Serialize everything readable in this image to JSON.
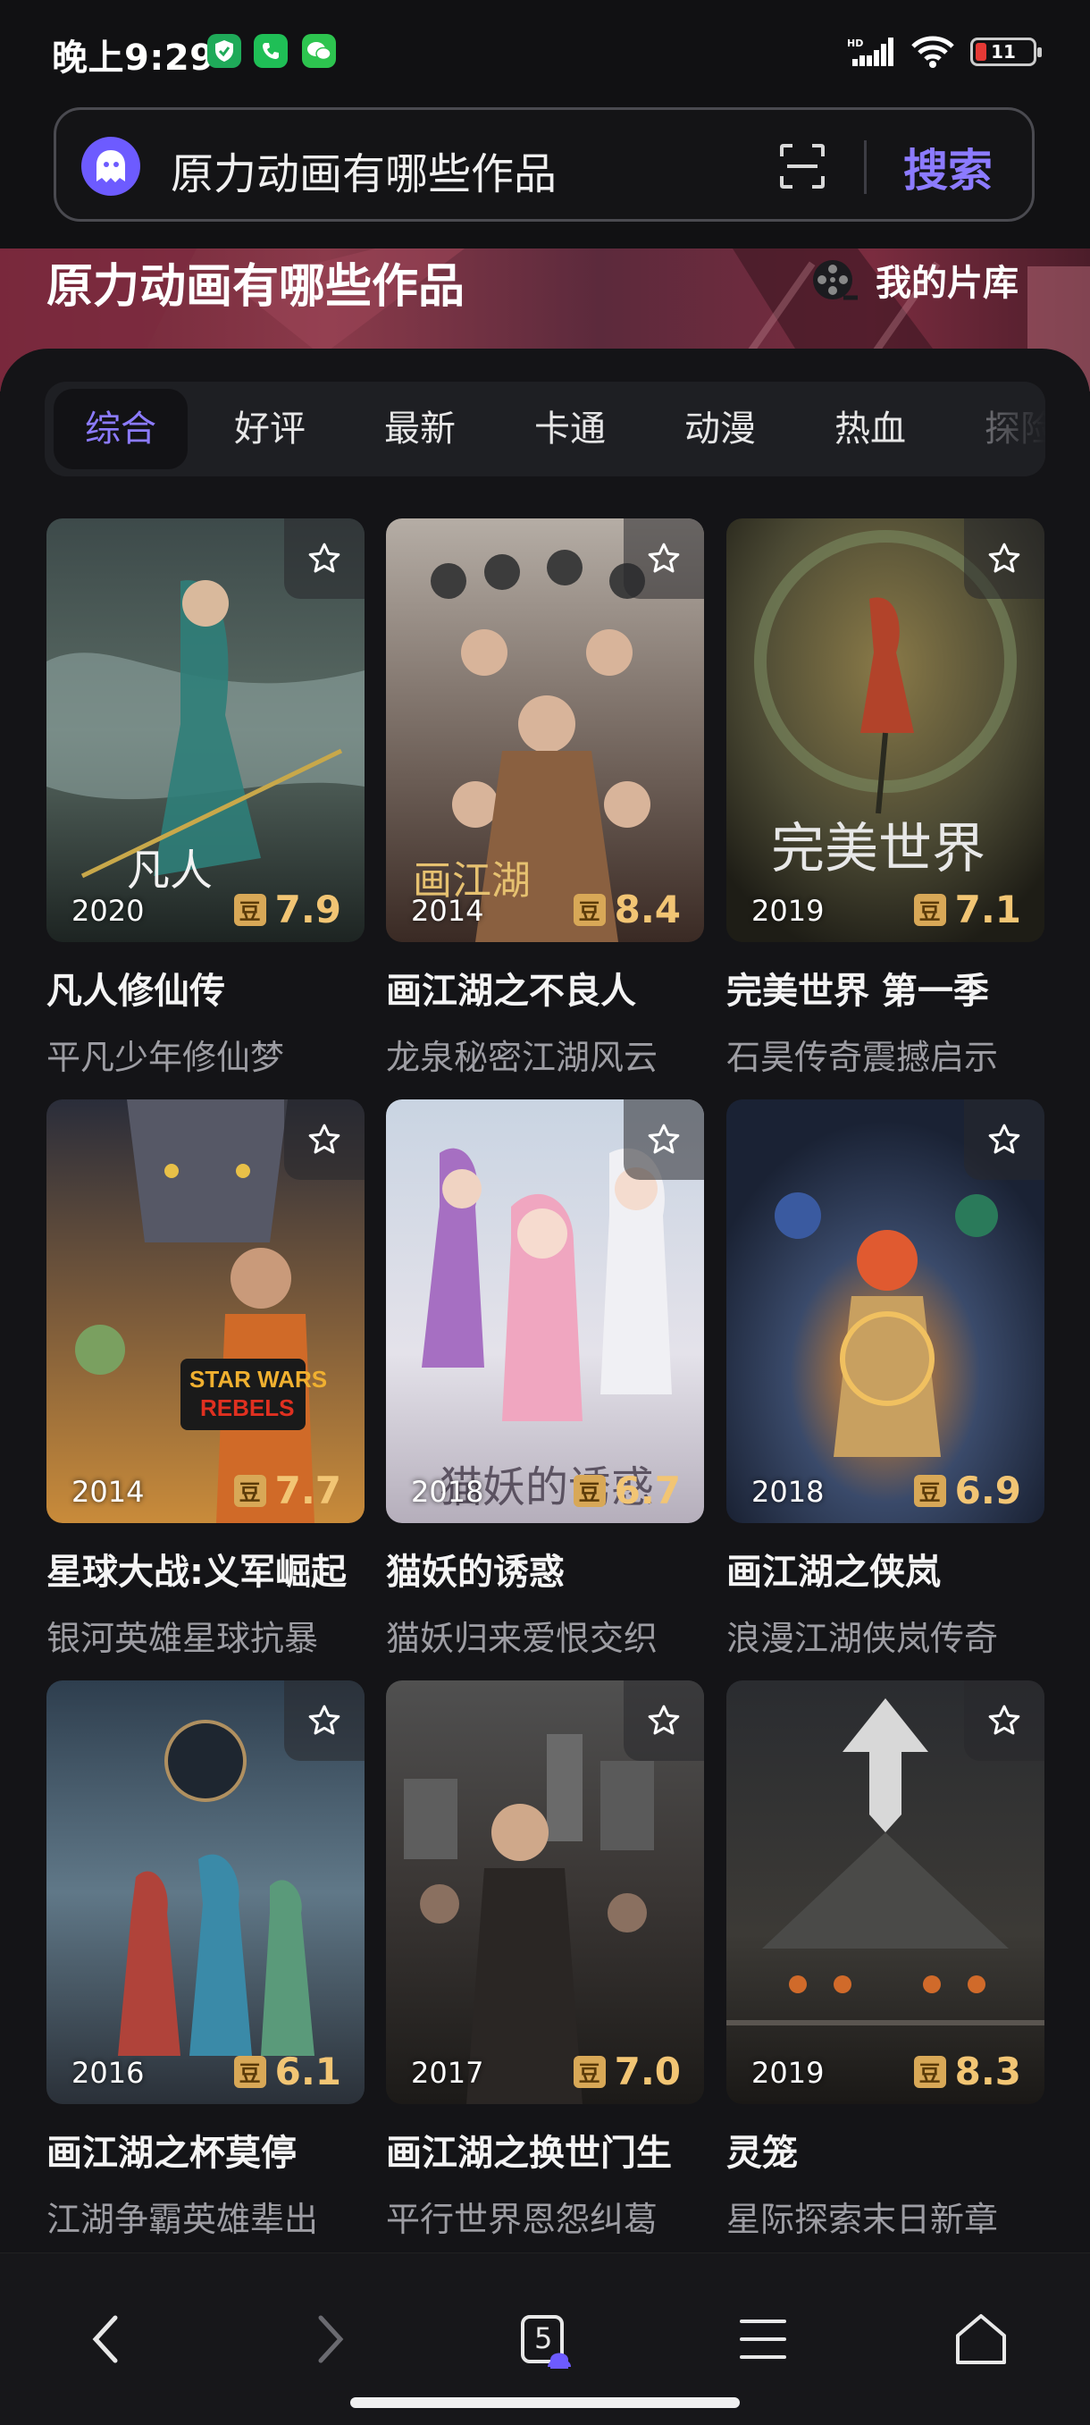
{
  "status_bar": {
    "time": "晚上9:29",
    "battery": "11"
  },
  "search": {
    "query": "原力动画有哪些作品",
    "button_label": "搜索"
  },
  "hero": {
    "title": "原力动画有哪些作品",
    "library_label": "我的片库"
  },
  "tabs": [
    "综合",
    "好评",
    "最新",
    "卡通",
    "动漫",
    "热血",
    "探险"
  ],
  "active_tab": "综合",
  "cards": [
    {
      "title": "凡人修仙传",
      "subtitle": "平凡少年修仙梦",
      "year": "2020",
      "score": "7.9",
      "dou": "豆"
    },
    {
      "title": "画江湖之不良人",
      "subtitle": "龙泉秘密江湖风云",
      "year": "2014",
      "score": "8.4",
      "dou": "豆"
    },
    {
      "title": "完美世界 第一季",
      "subtitle": "石昊传奇震撼启示",
      "year": "2019",
      "score": "7.1",
      "dou": "豆"
    },
    {
      "title": "星球大战:义军崛起",
      "subtitle": "银河英雄星球抗暴",
      "year": "2014",
      "score": "7.7",
      "dou": "豆"
    },
    {
      "title": "猫妖的诱惑",
      "subtitle": "猫妖归来爱恨交织",
      "year": "2018",
      "score": "6.7",
      "dou": "豆"
    },
    {
      "title": "画江湖之侠岚",
      "subtitle": "浪漫江湖侠岚传奇",
      "year": "2018",
      "score": "6.9",
      "dou": "豆"
    },
    {
      "title": "画江湖之杯莫停",
      "subtitle": "江湖争霸英雄辈出",
      "year": "2016",
      "score": "6.1",
      "dou": "豆"
    },
    {
      "title": "画江湖之换世门生",
      "subtitle": "平行世界恩怨纠葛",
      "year": "2017",
      "score": "7.0",
      "dou": "豆"
    },
    {
      "title": "灵笼",
      "subtitle": "星际探索末日新章",
      "year": "2019",
      "score": "8.3",
      "dou": "豆"
    }
  ],
  "bottom_nav": {
    "tab_count": "5"
  }
}
